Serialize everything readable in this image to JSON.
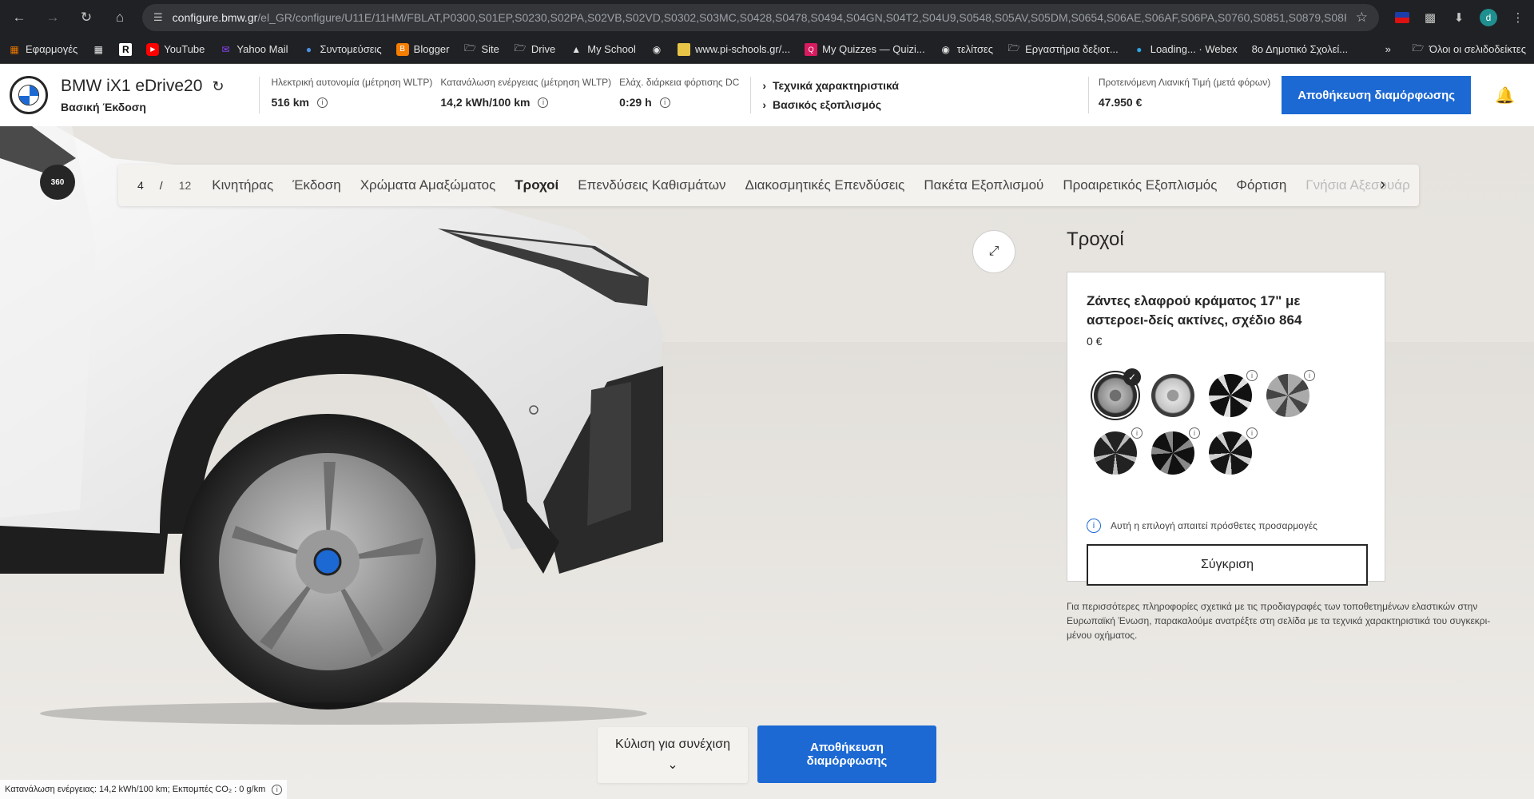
{
  "browser": {
    "url_host": "configure.bmw.gr",
    "url_path": "/el_GR/configure/U11E/11HM/FBLAT,P0300,S01EP,S0230,S02PA,S02VB,S02VD,S0302,S03MC,S0428,S0478,S0494,S04GN,S04T2,S04U9,S0548,S05AV,S05DM,S0654,S06AE,S06AF,S06PA,S0760,S0851,S0879,S08R3,S08R9,S08T...",
    "profile_initial": "d",
    "bookmarks": [
      {
        "label": "Εφαρμογές",
        "icon": "apps-grid-icon"
      },
      {
        "label": "",
        "icon": "grid-icon"
      },
      {
        "label": "",
        "icon": "r-icon"
      },
      {
        "label": "YouTube",
        "icon": "youtube-icon"
      },
      {
        "label": "Yahoo Mail",
        "icon": "mail-icon"
      },
      {
        "label": "Συντομεύσεις",
        "icon": "drop-icon"
      },
      {
        "label": "Blogger",
        "icon": "blogger-icon"
      },
      {
        "label": "Site",
        "icon": "folder-icon"
      },
      {
        "label": "Drive",
        "icon": "folder-icon"
      },
      {
        "label": "My School",
        "icon": "school-icon"
      },
      {
        "label": "",
        "icon": "globe-icon"
      },
      {
        "label": "www.pi-schools.gr/...",
        "icon": "page-icon"
      },
      {
        "label": "My Quizzes — Quizi...",
        "icon": "quiz-icon"
      },
      {
        "label": "τελίτσες",
        "icon": "globe-icon"
      },
      {
        "label": "Εργαστήρια δεξιοτ...",
        "icon": "folder-icon"
      },
      {
        "label": "Loading... · Webex",
        "icon": "webex-icon"
      },
      {
        "label": "8ο Δημοτικό Σχολεί...",
        "icon": ""
      }
    ],
    "more_label": "»",
    "all_bookmarks": "Όλοι οι σελιδοδείκτες"
  },
  "header": {
    "model_name": "BMW iX1 eDrive20",
    "edition": "Βασική Έκδοση",
    "specs": [
      {
        "label": "Ηλεκτρική αυτονομία (μέτρηση WLTP)",
        "value": "516 km"
      },
      {
        "label": "Κατανάλωση ενέργειας (μέτρηση WLTP)",
        "value": "14,2 kWh/100 km"
      },
      {
        "label": "Ελάχ. διάρκεια φόρτισης DC",
        "value": "0:29 h"
      }
    ],
    "links": [
      "Τεχνικά χαρακτηριστικά",
      "Βασικός εξοπλισμός"
    ],
    "price_label": "Προτεινόμενη Λιανική Τιμή (μετά φόρων)",
    "price_value": "47.950 €",
    "save_button": "Αποθήκευση διαμόρφωσης"
  },
  "stepper": {
    "current": "4",
    "separator": "/",
    "total": "12",
    "tabs": [
      "Κινητήρας",
      "Έκδοση",
      "Χρώματα Αμαξώματος",
      "Τροχοί",
      "Επενδύσεις Καθισμάτων",
      "Διακοσμητικές Επενδύσεις",
      "Πακέτα Εξοπλισμού",
      "Προαιρετικός Εξοπλισμός",
      "Φόρτιση",
      "Γνήσια Αξεσουάρ"
    ],
    "active_index": 3
  },
  "panel": {
    "title": "Τροχοί",
    "wheel_name": "Ζάντες ελαφρού κράματος 17\" με αστεροει-δείς ακτίνες, σχέδιο 864",
    "wheel_price": "0 €",
    "wheel_options": [
      {
        "style": "silver-grey",
        "selected": true,
        "info": false
      },
      {
        "style": "silver",
        "selected": false,
        "info": false
      },
      {
        "style": "black-bicolor",
        "selected": false,
        "info": true
      },
      {
        "style": "silver-star",
        "selected": false,
        "info": true
      },
      {
        "style": "black-multispoke",
        "selected": false,
        "info": true
      },
      {
        "style": "black-y",
        "selected": false,
        "info": true
      },
      {
        "style": "black-bicolor-2",
        "selected": false,
        "info": true
      }
    ],
    "note": "Αυτή η επιλογή απαιτεί πρόσθετες προσαρμογές",
    "compare_button": "Σύγκριση",
    "disclaimer": "Για περισσότερες πληροφορίες σχετικά με τις προδιαγραφές των τοποθετημένων ελαστικών στην Ευρωπαϊκή Ένωση, παρακαλούμε ανατρέξτε στη σελίδα με τα τεχνικά χαρακτηριστικά του συγκεκρι-μένου οχήματος."
  },
  "bottom": {
    "scroll_label": "Κύλιση για συνέχιση",
    "save_label": "Αποθήκευση διαμόρφωσης",
    "footer": "Κατανάλωση ενέργειας: 14,2 kWh/100 km; Εκπομπές CO₂ : 0 g/km"
  },
  "badge_360": "360",
  "colors": {
    "accent": "#1c69d4",
    "dark": "#262626"
  }
}
